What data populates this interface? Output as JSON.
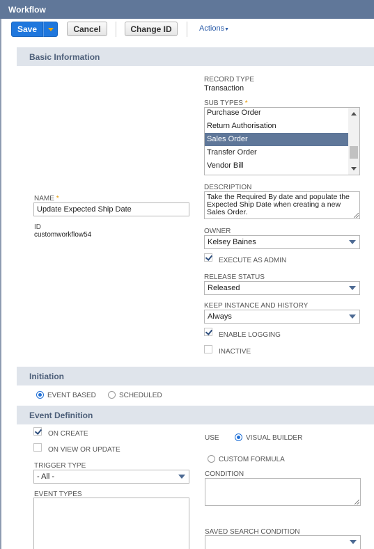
{
  "window": {
    "title": "Workflow"
  },
  "toolbar": {
    "save_label": "Save",
    "cancel_label": "Cancel",
    "change_id_label": "Change ID",
    "actions_label": "Actions"
  },
  "basic_info": {
    "section_title": "Basic Information",
    "record_type_label": "RECORD TYPE",
    "record_type_value": "Transaction",
    "sub_types_label": "SUB TYPES",
    "sub_types": [
      "Purchase Order",
      "Return Authorisation",
      "Sales Order",
      "Transfer Order",
      "Vendor Bill"
    ],
    "sub_types_selected": "Sales Order",
    "name_label": "NAME",
    "name_value": "Update Expected Ship Date",
    "id_label": "ID",
    "id_value": "customworkflow54",
    "description_label": "DESCRIPTION",
    "description_value": "Take the Required By date and populate the Expected Ship Date when creating a new Sales Order.",
    "owner_label": "OWNER",
    "owner_value": "Kelsey Baines",
    "execute_as_admin_label": "EXECUTE AS ADMIN",
    "execute_as_admin_checked": true,
    "release_status_label": "RELEASE STATUS",
    "release_status_value": "Released",
    "keep_instance_label": "KEEP INSTANCE AND HISTORY",
    "keep_instance_value": "Always",
    "enable_logging_label": "ENABLE LOGGING",
    "enable_logging_checked": true,
    "inactive_label": "INACTIVE",
    "inactive_checked": false
  },
  "initiation": {
    "section_title": "Initiation",
    "event_based_label": "EVENT BASED",
    "scheduled_label": "SCHEDULED",
    "selected": "EVENT BASED"
  },
  "event_definition": {
    "section_title": "Event Definition",
    "on_create_label": "ON CREATE",
    "on_create_checked": true,
    "on_view_update_label": "ON VIEW OR UPDATE",
    "on_view_update_checked": false,
    "trigger_type_label": "TRIGGER TYPE",
    "trigger_type_value": "- All -",
    "event_types_label": "EVENT TYPES",
    "use_label": "USE",
    "visual_builder_label": "VISUAL BUILDER",
    "custom_formula_label": "CUSTOM FORMULA",
    "use_selected": "VISUAL BUILDER",
    "condition_label": "CONDITION",
    "saved_search_label": "SAVED SEARCH CONDITION",
    "saved_search_value": ""
  },
  "colors": {
    "header": "#607799",
    "section_bg": "#dfe4eb",
    "save_button": "#1f77dd",
    "selected_option": "#5f7799"
  }
}
